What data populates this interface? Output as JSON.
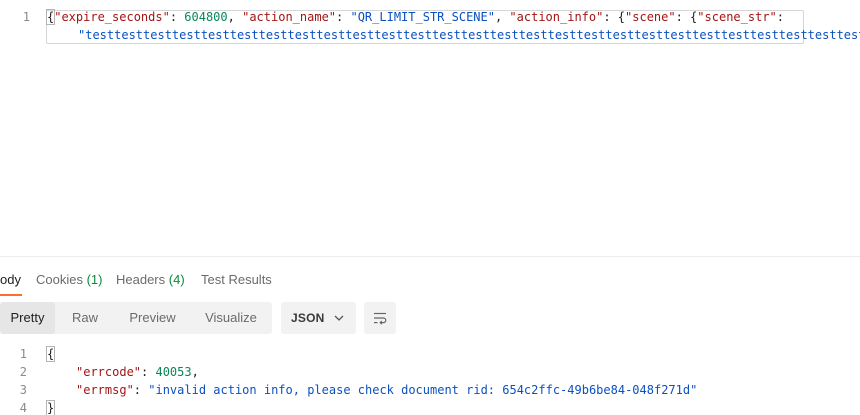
{
  "request_editor": {
    "line_number": "1",
    "line1": {
      "k1": "\"expire_seconds\"",
      "v1": "604800",
      "k2": "\"action_name\"",
      "v2": "\"QR_LIMIT_STR_SCENE\"",
      "k3": "\"action_info\"",
      "k4": "\"scene\"",
      "k5": "\"scene_str\""
    },
    "line1_wrap": {
      "v5": "\"testtesttesttesttesttesttesttesttesttesttesttesttesttesttesttesttesttesttesttesttesttesttesttesttesttesttest\""
    }
  },
  "response_tabs": [
    {
      "label": "ody",
      "count": ""
    },
    {
      "label": "Cookies",
      "count": "(1)"
    },
    {
      "label": "Headers",
      "count": "(4)"
    },
    {
      "label": "Test Results",
      "count": ""
    }
  ],
  "format_bar": {
    "modes": [
      "Pretty",
      "Raw",
      "Preview",
      "Visualize"
    ],
    "active_mode": "Pretty",
    "language": "JSON",
    "language_icon": "chevron-down-icon",
    "wrap_icon": "wrap-lines-icon"
  },
  "response_body": {
    "line_numbers": [
      "1",
      "2",
      "3",
      "4"
    ],
    "open": "{",
    "errcode_key": "\"errcode\"",
    "errcode_value": "40053",
    "errmsg_key": "\"errmsg\"",
    "errmsg_value": "\"invalid action info, please check document rid: 654c2ffc-49b6be84-048f271d\"",
    "close": "}"
  },
  "colors": {
    "accent": "#ff6c37",
    "json_key": "#a31515",
    "json_string": "#0b51c1",
    "json_number": "#098658",
    "count_green": "#0a8a3a"
  }
}
